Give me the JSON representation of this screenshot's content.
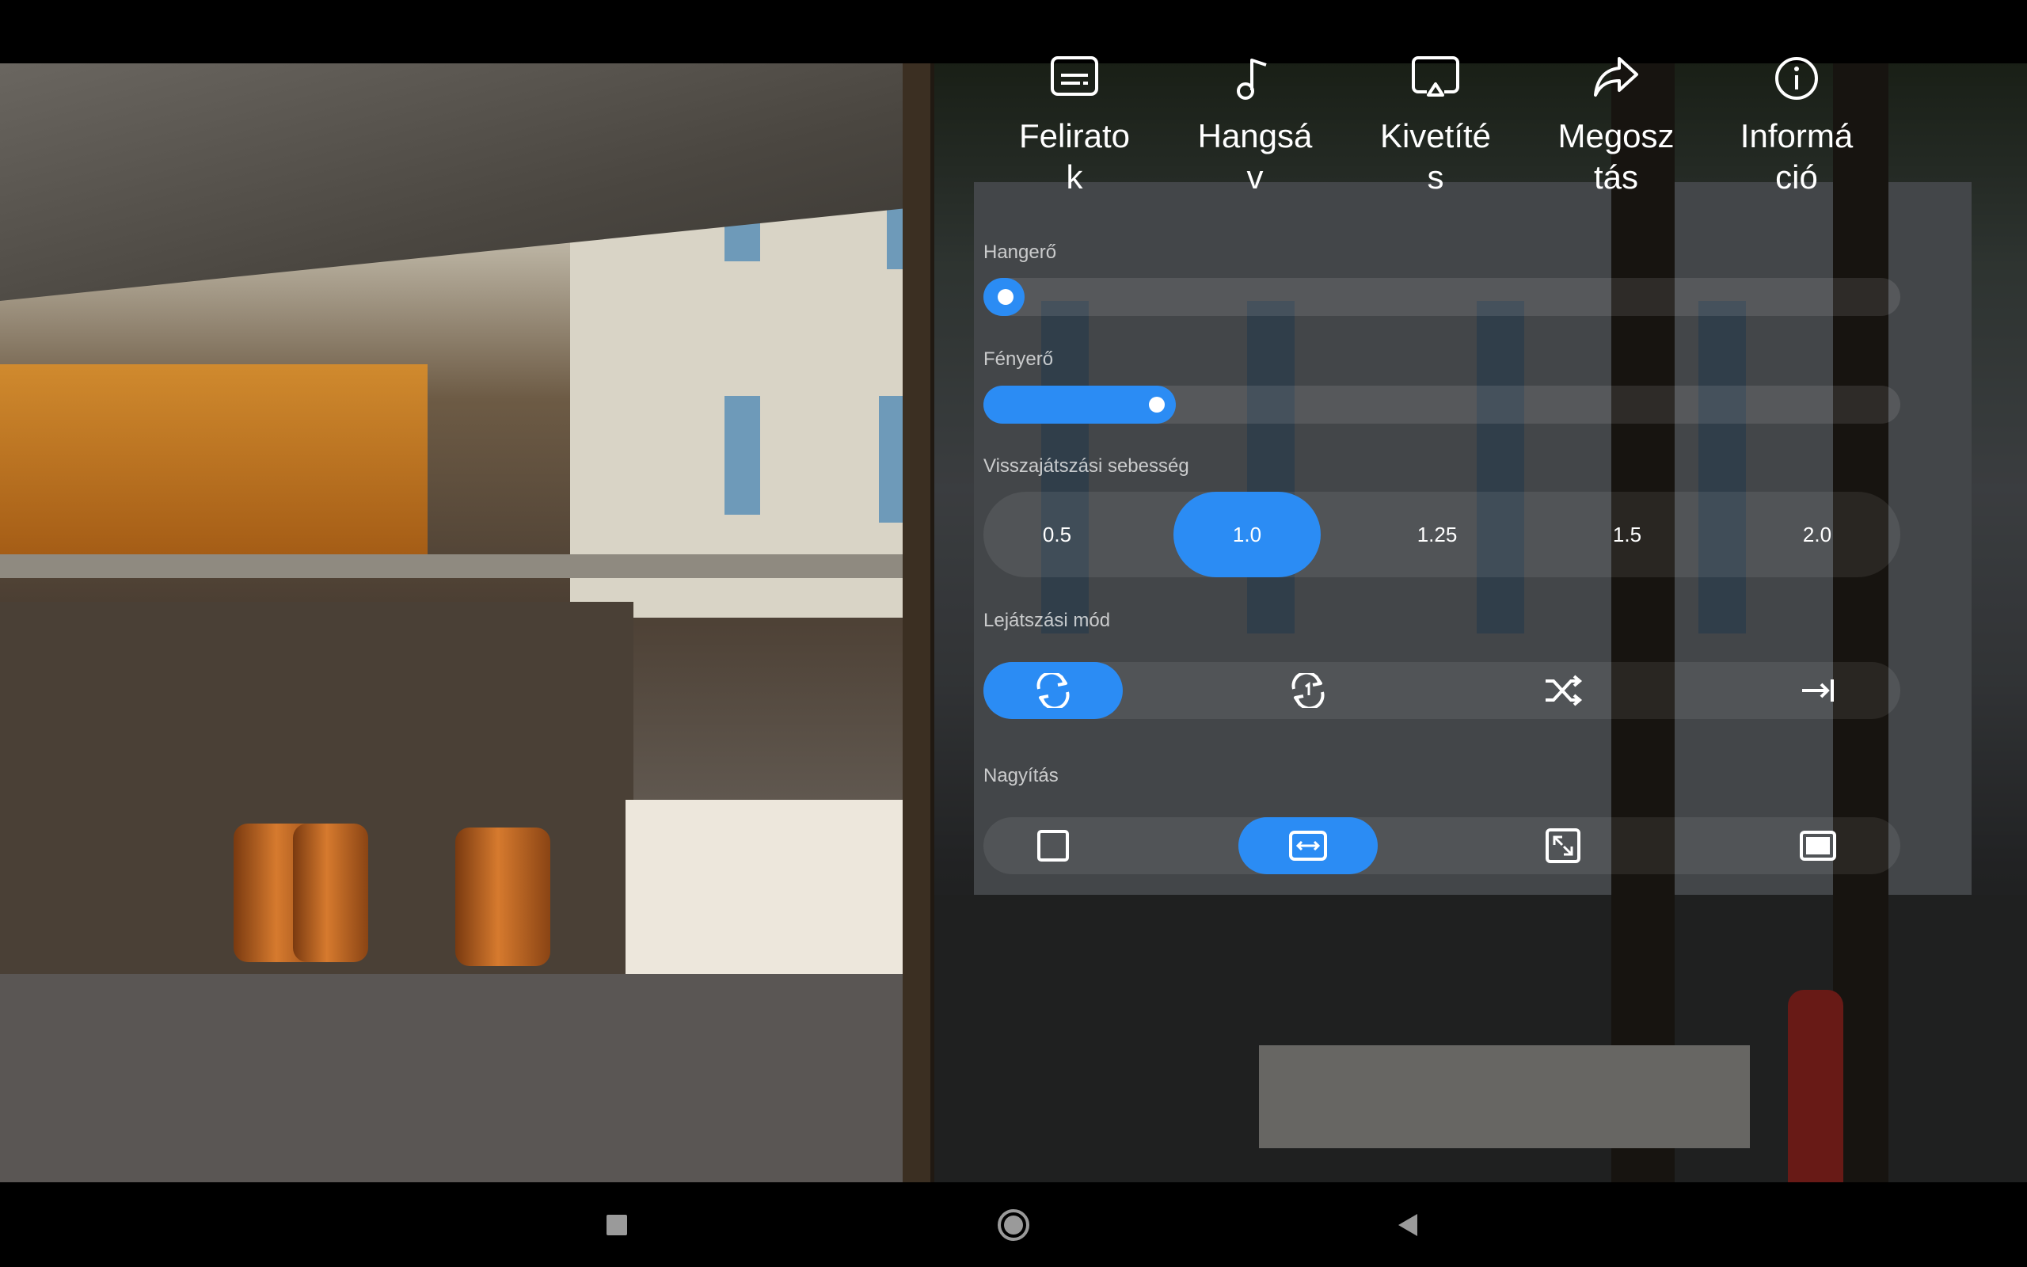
{
  "actions": [
    {
      "label": "Feliratok",
      "icon": "subtitles-icon"
    },
    {
      "label": "Hangsáv",
      "icon": "music-note-icon"
    },
    {
      "label": "Kivetítés",
      "icon": "cast-icon"
    },
    {
      "label": "Megosztás",
      "icon": "share-icon"
    },
    {
      "label": "Információ",
      "icon": "info-icon"
    }
  ],
  "volume": {
    "label": "Hangerő",
    "level": 0.0
  },
  "brightness": {
    "label": "Fényerő",
    "level": 0.21
  },
  "speed": {
    "label": "Visszajátszási sebesség",
    "options": [
      "0.5",
      "1.0",
      "1.25",
      "1.5",
      "2.0"
    ],
    "selected": "1.0"
  },
  "play_mode": {
    "label": "Lejátszási mód",
    "options": [
      "repeat-all-icon",
      "repeat-one-icon",
      "shuffle-icon",
      "play-once-icon"
    ],
    "selected": "repeat-all-icon"
  },
  "zoom": {
    "label": "Nagyítás",
    "options": [
      "fit-square-icon",
      "fit-width-icon",
      "fullscreen-icon",
      "crop-icon"
    ],
    "selected": "fit-width-icon"
  },
  "accent_color": "#2b8cf4",
  "navigation": [
    "recents-icon",
    "home-icon",
    "back-icon"
  ]
}
